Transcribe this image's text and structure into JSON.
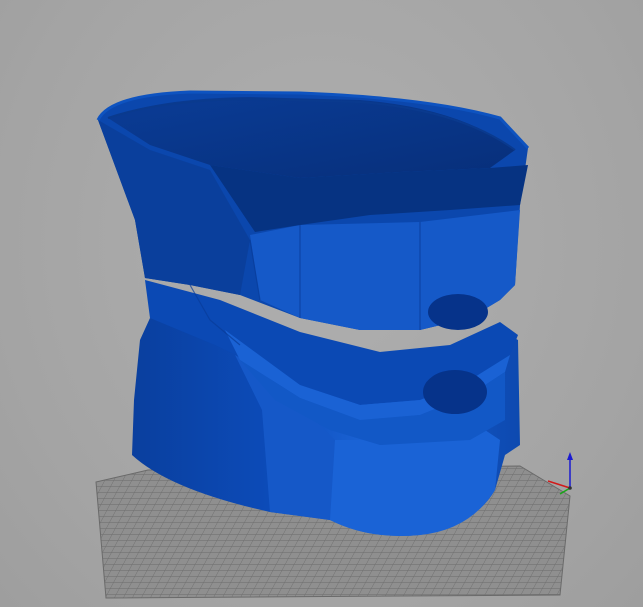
{
  "viewer": {
    "background_color": "#a6a6a6",
    "bed_grid_color": "#7a7a7a",
    "bed_fill_color": "#8d8d8d",
    "model_color_main": "#0a47b0",
    "model_color_light": "#1a63d6",
    "model_color_dark": "#06338a",
    "model_color_darkest": "#042566"
  },
  "axes_gizmo": {
    "x_axis_color": "#d11a1a",
    "y_axis_color": "#18a818",
    "z_axis_color": "#1a1ad1"
  }
}
